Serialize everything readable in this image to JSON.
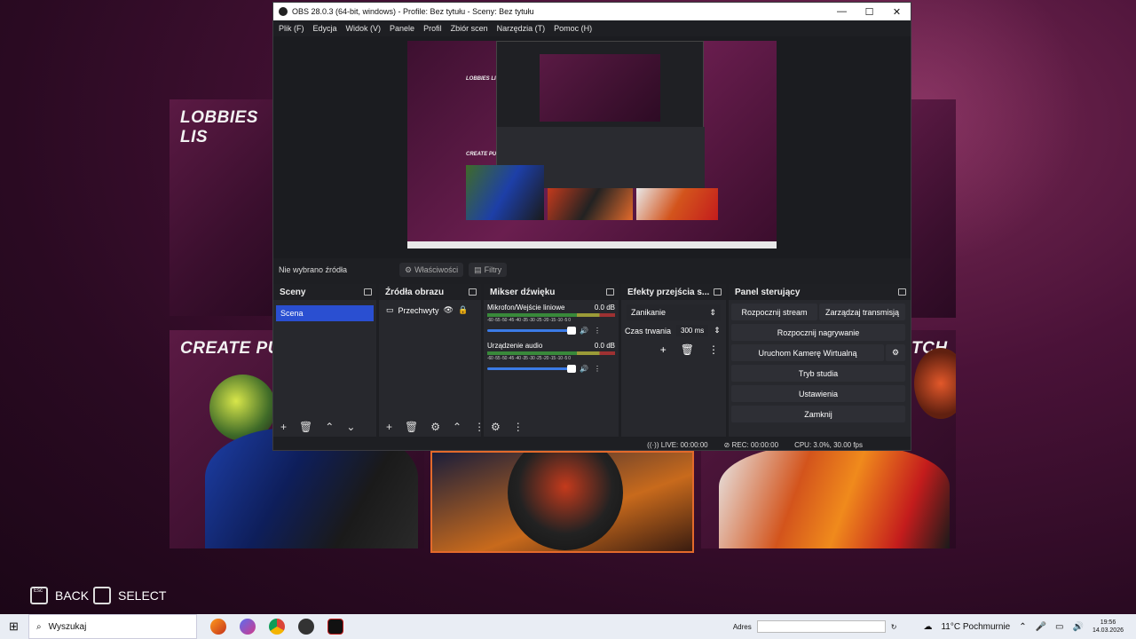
{
  "game": {
    "card1_title": "LOBBIES LIS",
    "card2_title": "CREATE PUE",
    "card3_title": "TCH",
    "back_label": "BACK",
    "select_label": "SELECT",
    "esc_label": "Esc"
  },
  "obs": {
    "window_title": "OBS 28.0.3 (64-bit, windows) - Profile: Bez tytułu - Sceny: Bez tytułu",
    "window_buttons": {
      "minimize": "—",
      "maximize": "☐",
      "close": "✕"
    },
    "menu": [
      "Plik (F)",
      "Edycja",
      "Widok (V)",
      "Panele",
      "Profil",
      "Zbiór scen",
      "Narzędzia (T)",
      "Pomoc (H)"
    ],
    "preview": {
      "lbl1": "LOBBIES LIS",
      "lbl2": "CREATE PUE"
    },
    "source_bar": {
      "no_source": "Nie wybrano źródła",
      "properties": "Właściwości",
      "filters": "Filtry"
    },
    "docks": {
      "scenes": {
        "title": "Sceny",
        "items": [
          "Scena"
        ]
      },
      "sources": {
        "title": "Źródła obrazu",
        "items": [
          "Przechwyty"
        ]
      },
      "mixer": {
        "title": "Mikser dźwięku",
        "channels": [
          {
            "name": "Mikrofon/Wejście liniowe",
            "level": "0.0 dB"
          },
          {
            "name": "Urządzenie audio",
            "level": "0.0 dB"
          }
        ],
        "ticks": "-60 -55 -50 -45 -40 -35 -30 -25 -20 -15 -10 -5 0"
      },
      "transitions": {
        "title": "Efekty przejścia s...",
        "effect": "Zanikanie",
        "duration_label": "Czas trwania",
        "duration_value": "300 ms"
      },
      "controls": {
        "title": "Panel sterujący",
        "start_stream": "Rozpocznij stream",
        "manage_stream": "Zarządzaj transmisją",
        "start_recording": "Rozpocznij nagrywanie",
        "virtual_cam": "Uruchom Kamerę Wirtualną",
        "studio_mode": "Tryb studia",
        "settings": "Ustawienia",
        "exit": "Zamknij"
      }
    },
    "status": {
      "live": "LIVE: 00:00:00",
      "rec": "REC: 00:00:00",
      "cpu": "CPU: 3.0%, 30.00 fps"
    }
  },
  "taskbar": {
    "search_placeholder": "Wyszukaj",
    "address_label": "Adres",
    "weather": "11°C  Pochmurnie",
    "time": "19:56",
    "date": "14.03.2026"
  }
}
